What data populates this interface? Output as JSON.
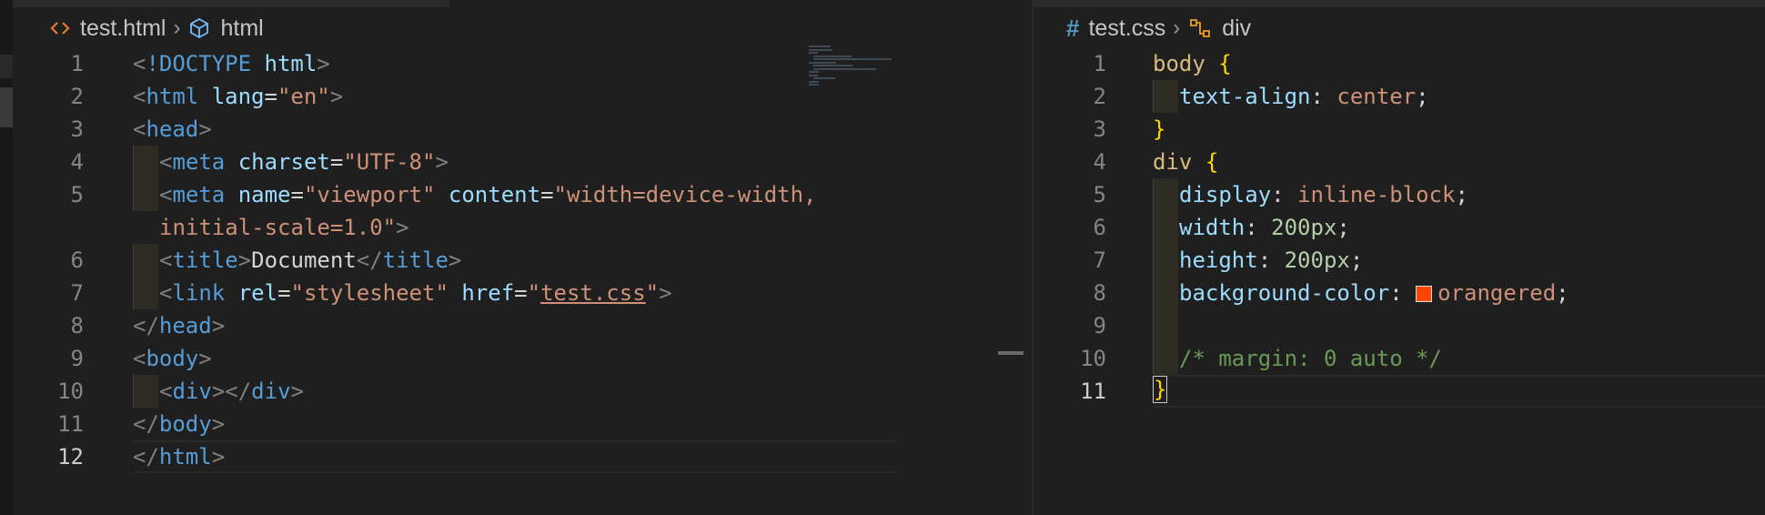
{
  "left_editor": {
    "breadcrumb": {
      "file_icon": "code-file-icon",
      "file": "test.html",
      "symbol_icon": "cube-icon",
      "symbol": "html"
    },
    "active_line": 12,
    "line_numbers": [
      "1",
      "2",
      "3",
      "4",
      "5",
      "",
      "6",
      "7",
      "8",
      "9",
      "10",
      "11",
      "12"
    ],
    "lines": [
      {
        "indent": 0,
        "tokens": [
          [
            "t-punct",
            "<"
          ],
          [
            "t-tag",
            "!DOCTYPE"
          ],
          [
            "t-text",
            " "
          ],
          [
            "t-attr",
            "html"
          ],
          [
            "t-punct",
            ">"
          ]
        ]
      },
      {
        "indent": 0,
        "tokens": [
          [
            "t-punct",
            "<"
          ],
          [
            "t-tag",
            "html"
          ],
          [
            "t-text",
            " "
          ],
          [
            "t-attr",
            "lang"
          ],
          [
            "t-text",
            "="
          ],
          [
            "t-str",
            "\"en\""
          ],
          [
            "t-punct",
            ">"
          ]
        ]
      },
      {
        "indent": 0,
        "tokens": [
          [
            "t-punct",
            "<"
          ],
          [
            "t-tag",
            "head"
          ],
          [
            "t-punct",
            ">"
          ]
        ]
      },
      {
        "indent": 1,
        "tokens": [
          [
            "t-punct",
            "<"
          ],
          [
            "t-tag",
            "meta"
          ],
          [
            "t-text",
            " "
          ],
          [
            "t-attr",
            "charset"
          ],
          [
            "t-text",
            "="
          ],
          [
            "t-str",
            "\"UTF-8\""
          ],
          [
            "t-punct",
            ">"
          ]
        ]
      },
      {
        "indent": 1,
        "tokens": [
          [
            "t-punct",
            "<"
          ],
          [
            "t-tag",
            "meta"
          ],
          [
            "t-text",
            " "
          ],
          [
            "t-attr",
            "name"
          ],
          [
            "t-text",
            "="
          ],
          [
            "t-str",
            "\"viewport\""
          ],
          [
            "t-text",
            " "
          ],
          [
            "t-attr",
            "content"
          ],
          [
            "t-text",
            "="
          ],
          [
            "t-str",
            "\"width=device-width,"
          ]
        ]
      },
      {
        "indent": 0,
        "wrap": true,
        "tokens": [
          [
            "t-str",
            "initial-scale=1.0\""
          ],
          [
            "t-punct",
            ">"
          ]
        ]
      },
      {
        "indent": 1,
        "tokens": [
          [
            "t-punct",
            "<"
          ],
          [
            "t-tag",
            "title"
          ],
          [
            "t-punct",
            ">"
          ],
          [
            "t-text",
            "Document"
          ],
          [
            "t-punct",
            "</"
          ],
          [
            "t-tag",
            "title"
          ],
          [
            "t-punct",
            ">"
          ]
        ]
      },
      {
        "indent": 1,
        "tokens": [
          [
            "t-punct",
            "<"
          ],
          [
            "t-tag",
            "link"
          ],
          [
            "t-text",
            " "
          ],
          [
            "t-attr",
            "rel"
          ],
          [
            "t-text",
            "="
          ],
          [
            "t-str",
            "\"stylesheet\""
          ],
          [
            "t-text",
            " "
          ],
          [
            "t-attr",
            "href"
          ],
          [
            "t-text",
            "="
          ],
          [
            "t-str",
            "\""
          ],
          [
            "t-str link-underline",
            "test.css"
          ],
          [
            "t-str",
            "\""
          ],
          [
            "t-punct",
            ">"
          ]
        ]
      },
      {
        "indent": 0,
        "tokens": [
          [
            "t-punct",
            "</"
          ],
          [
            "t-tag",
            "head"
          ],
          [
            "t-punct",
            ">"
          ]
        ]
      },
      {
        "indent": 0,
        "tokens": [
          [
            "t-punct",
            "<"
          ],
          [
            "t-tag",
            "body"
          ],
          [
            "t-punct",
            ">"
          ]
        ]
      },
      {
        "indent": 1,
        "tokens": [
          [
            "t-punct",
            "<"
          ],
          [
            "t-tag",
            "div"
          ],
          [
            "t-punct",
            "></"
          ],
          [
            "t-tag",
            "div"
          ],
          [
            "t-punct",
            ">"
          ]
        ]
      },
      {
        "indent": 0,
        "tokens": [
          [
            "t-punct",
            "</"
          ],
          [
            "t-tag",
            "body"
          ],
          [
            "t-punct",
            ">"
          ]
        ]
      },
      {
        "indent": 0,
        "tokens": [
          [
            "t-punct",
            "</"
          ],
          [
            "t-tag",
            "html"
          ],
          [
            "t-punct",
            ">"
          ]
        ]
      }
    ]
  },
  "right_editor": {
    "breadcrumb": {
      "file_icon": "hash-icon",
      "file": "test.css",
      "symbol_icon": "symbol-structure-icon",
      "symbol": "div"
    },
    "active_line": 11,
    "swatch_color": "#ff4500",
    "line_numbers": [
      "1",
      "2",
      "3",
      "4",
      "5",
      "6",
      "7",
      "8",
      "9",
      "10",
      "11"
    ],
    "lines": [
      {
        "indent": 0,
        "tokens": [
          [
            "t-sel",
            "body"
          ],
          [
            "t-text",
            " "
          ],
          [
            "t-brace",
            "{"
          ]
        ]
      },
      {
        "indent": 1,
        "tokens": [
          [
            "t-prop",
            "text-align"
          ],
          [
            "t-text",
            ": "
          ],
          [
            "t-val",
            "center"
          ],
          [
            "t-text",
            ";"
          ]
        ]
      },
      {
        "indent": 0,
        "tokens": [
          [
            "t-brace",
            "}"
          ]
        ]
      },
      {
        "indent": 0,
        "tokens": [
          [
            "t-sel",
            "div"
          ],
          [
            "t-text",
            " "
          ],
          [
            "t-brace",
            "{"
          ]
        ]
      },
      {
        "indent": 1,
        "tokens": [
          [
            "t-prop",
            "display"
          ],
          [
            "t-text",
            ": "
          ],
          [
            "t-val",
            "inline-block"
          ],
          [
            "t-text",
            ";"
          ]
        ]
      },
      {
        "indent": 1,
        "tokens": [
          [
            "t-prop",
            "width"
          ],
          [
            "t-text",
            ": "
          ],
          [
            "t-num",
            "200px"
          ],
          [
            "t-text",
            ";"
          ]
        ]
      },
      {
        "indent": 1,
        "tokens": [
          [
            "t-prop",
            "height"
          ],
          [
            "t-text",
            ": "
          ],
          [
            "t-num",
            "200px"
          ],
          [
            "t-text",
            ";"
          ]
        ]
      },
      {
        "indent": 1,
        "tokens": [
          [
            "t-prop",
            "background-color"
          ],
          [
            "t-text",
            ": "
          ],
          [
            "swatch",
            ""
          ],
          [
            "t-val",
            "orangered"
          ],
          [
            "t-text",
            ";"
          ]
        ]
      },
      {
        "indent": 1,
        "tokens": []
      },
      {
        "indent": 1,
        "tokens": [
          [
            "t-com",
            "/* margin: 0 auto */"
          ]
        ]
      },
      {
        "indent": 0,
        "tokens": [
          [
            "t-brace cursor",
            "}"
          ]
        ]
      }
    ]
  }
}
